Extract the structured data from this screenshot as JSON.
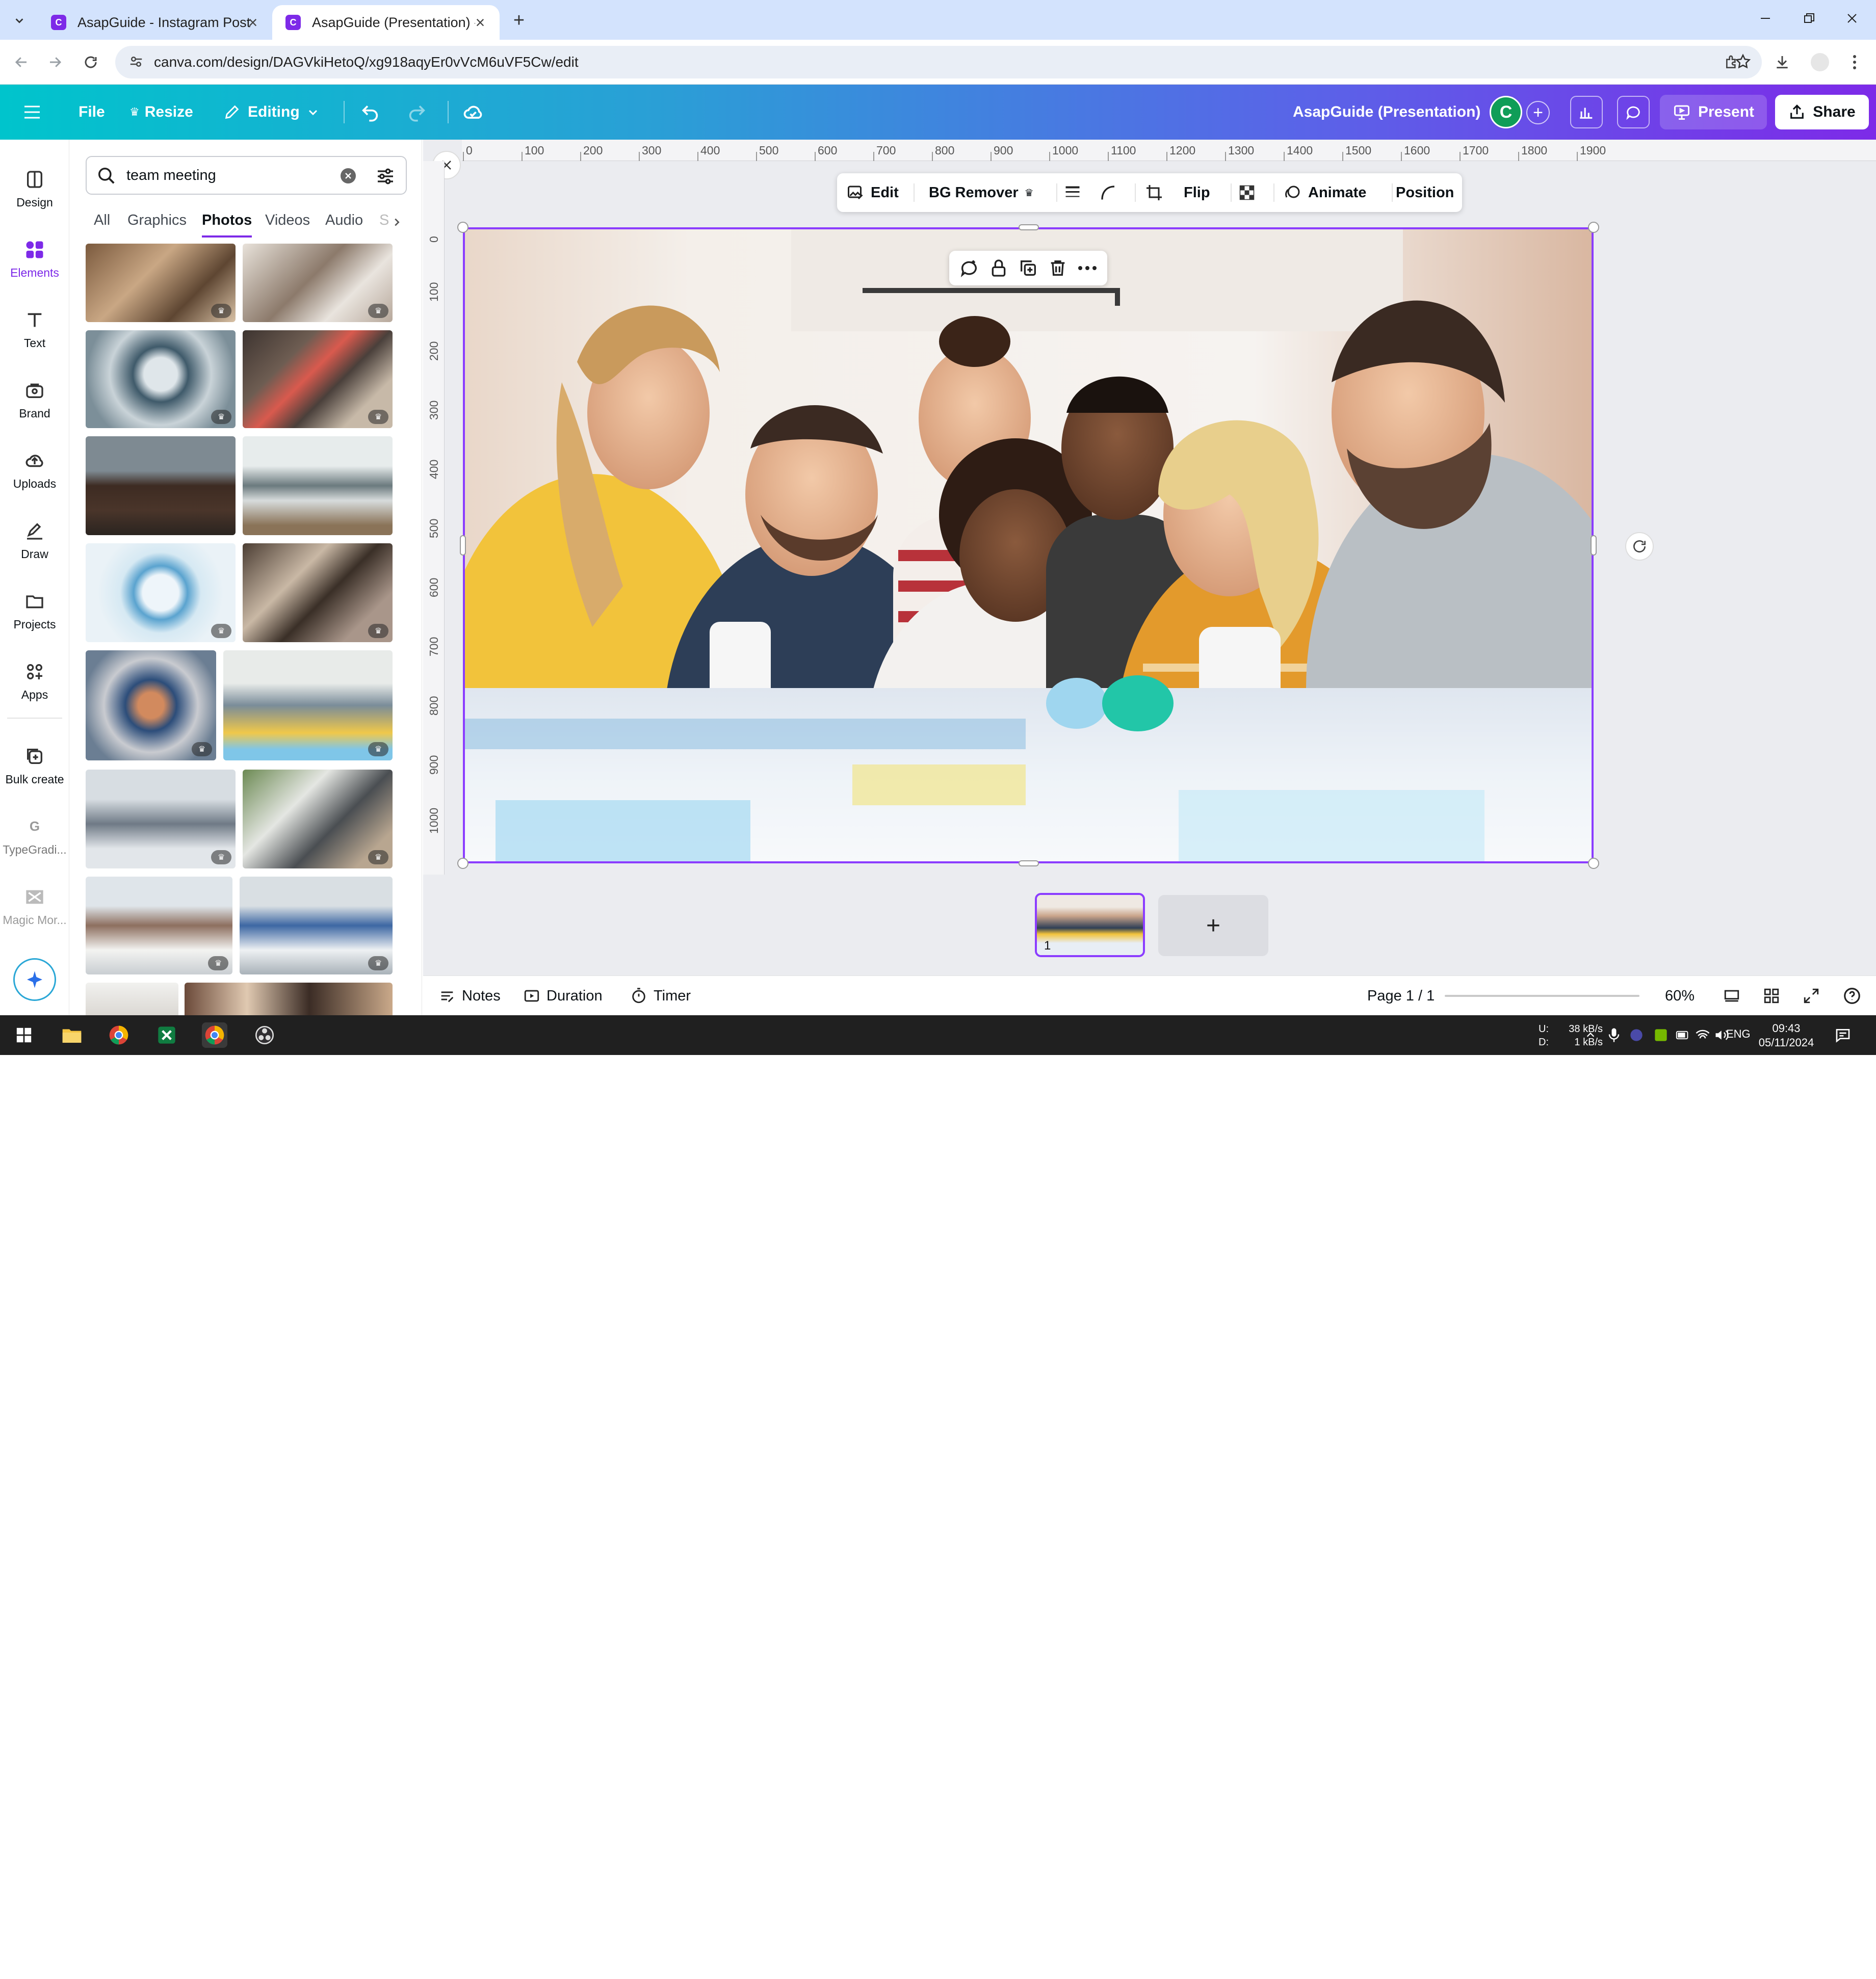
{
  "browser": {
    "tabs": [
      {
        "title": "AsapGuide - Instagram Post"
      },
      {
        "title": "AsapGuide (Presentation) - Pres"
      }
    ],
    "url": "canva.com/design/DAGVkiHetoQ/xg918aqyEr0vVcM6uVF5Cw/edit"
  },
  "header": {
    "file_label": "File",
    "resize_label": "Resize",
    "editing_label": "Editing",
    "doc_title": "AsapGuide (Presentation)",
    "avatar_letter": "C",
    "present_label": "Present",
    "share_label": "Share",
    "brand_color": "#7d2ae8",
    "avatar_color": "#0f9d58"
  },
  "leftrail": {
    "items": [
      {
        "label": "Design",
        "icon": "design-icon"
      },
      {
        "label": "Elements",
        "icon": "elements-icon"
      },
      {
        "label": "Text",
        "icon": "text-icon"
      },
      {
        "label": "Brand",
        "icon": "brand-icon"
      },
      {
        "label": "Uploads",
        "icon": "uploads-icon"
      },
      {
        "label": "Draw",
        "icon": "draw-icon"
      },
      {
        "label": "Projects",
        "icon": "projects-icon"
      },
      {
        "label": "Apps",
        "icon": "apps-icon"
      },
      {
        "label": "Bulk create",
        "icon": "bulk-create-icon"
      },
      {
        "label": "TypeGradi...",
        "icon": "typegradient-icon"
      },
      {
        "label": "Magic Mor...",
        "icon": "magic-morph-icon"
      }
    ]
  },
  "panel": {
    "search_value": "team meeting",
    "tabs": [
      "All",
      "Graphics",
      "Photos",
      "Videos",
      "Audio",
      "S"
    ],
    "active_tab": "Photos"
  },
  "ruler": {
    "top": [
      "0",
      "100",
      "200",
      "300",
      "400",
      "500",
      "600",
      "700",
      "800",
      "900",
      "1000",
      "1100",
      "1200",
      "1300",
      "1400",
      "1500",
      "1600",
      "1700",
      "1800",
      "1900"
    ],
    "left": [
      "0",
      "100",
      "200",
      "300",
      "400",
      "500",
      "600",
      "700",
      "800",
      "900",
      "1000"
    ]
  },
  "toolbar": {
    "edit_label": "Edit",
    "bg_remover_label": "BG Remover",
    "flip_label": "Flip",
    "animate_label": "Animate",
    "position_label": "Position"
  },
  "pages": {
    "thumb_number": "1",
    "add_label": "+"
  },
  "bottombar": {
    "notes_label": "Notes",
    "duration_label": "Duration",
    "timer_label": "Timer",
    "page_indicator": "Page 1 / 1",
    "zoom_label": "60%",
    "zoom_level": 0.6
  },
  "taskbar": {
    "net_up": "38 kB/s",
    "net_down": "1 kB/s",
    "net_u_label": "U:",
    "net_d_label": "D:",
    "lang": "ENG",
    "time": "09:43",
    "date": "05/11/2024"
  }
}
